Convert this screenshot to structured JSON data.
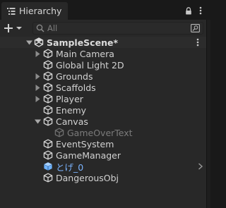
{
  "tab": {
    "title": "Hierarchy"
  },
  "toolbar": {
    "create_label": "+",
    "search_placeholder": "All"
  },
  "scene": {
    "name": "SampleScene*"
  },
  "items": [
    {
      "label": "Main Camera",
      "style": "normal",
      "foldout": true
    },
    {
      "label": "Global Light 2D",
      "style": "normal",
      "foldout": false
    },
    {
      "label": "Grounds",
      "style": "normal",
      "foldout": true
    },
    {
      "label": "Scaffolds",
      "style": "normal",
      "foldout": true
    },
    {
      "label": "Player",
      "style": "normal",
      "foldout": true
    },
    {
      "label": "Enemy",
      "style": "normal",
      "foldout": false
    },
    {
      "label": "Canvas",
      "style": "normal",
      "foldout": "expanded"
    },
    {
      "label": "GameOverText",
      "style": "inactive",
      "foldout": false
    },
    {
      "label": "EventSystem",
      "style": "normal",
      "foldout": false
    },
    {
      "label": "GameManager",
      "style": "normal",
      "foldout": false
    },
    {
      "label": "とげ_0",
      "style": "prefab",
      "foldout": false
    },
    {
      "label": "DangerousObj",
      "style": "normal",
      "foldout": false
    }
  ],
  "icons": {
    "tab": "hierarchy-list-icon",
    "lock": "lock-icon",
    "menu": "kebab-menu-icon",
    "scene": "unity-scene-icon",
    "gameobject": "cube-icon",
    "prefab": "prefab-cube-icon",
    "search": "search-icon",
    "filter": "scene-filter-icon"
  },
  "colors": {
    "panel": "#282828",
    "text": "#d2d2d2",
    "inactive_text": "#7b7b7b",
    "prefab_text": "#7bb4ff"
  }
}
